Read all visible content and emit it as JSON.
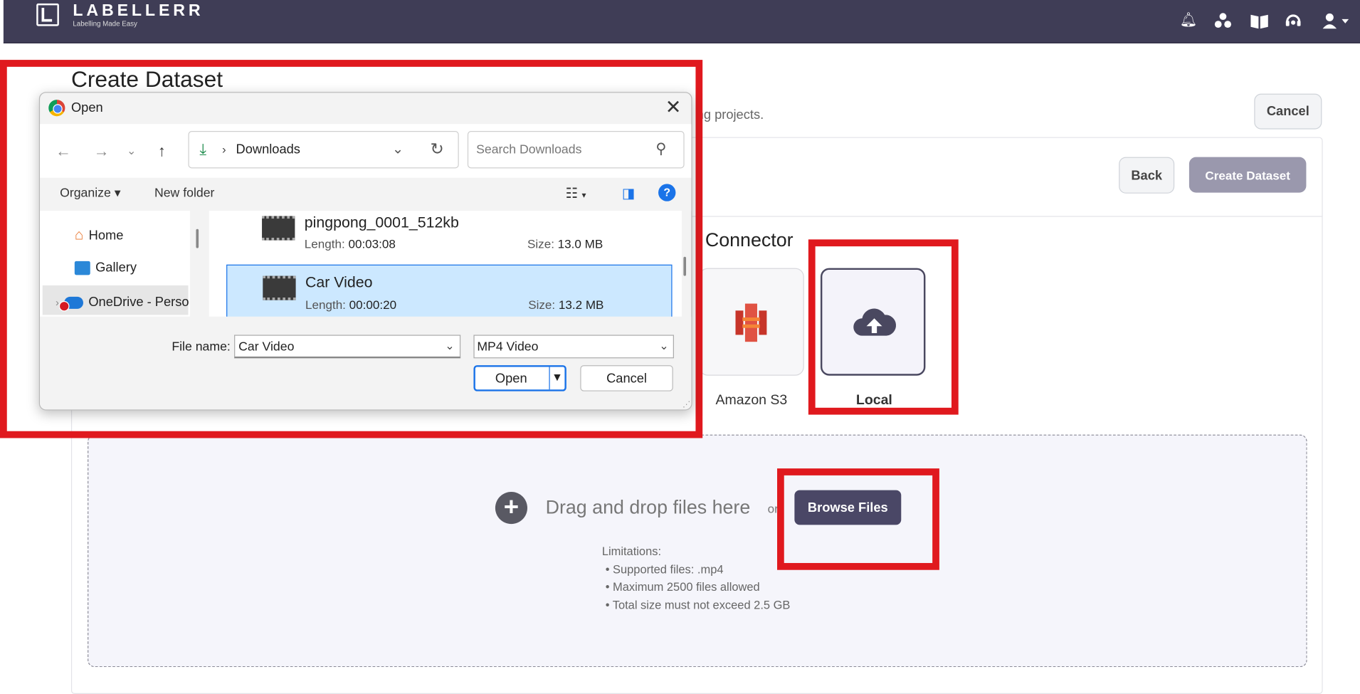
{
  "topbar": {
    "logo_name": "LABELLERR",
    "logo_tagline": "Labelling Made Easy",
    "icons": [
      "bell-icon",
      "team-icon",
      "book-icon",
      "support-icon",
      "user-icon"
    ]
  },
  "page": {
    "title": "Create Dataset",
    "subtitle_fragment": "ng projects.",
    "cancel_label": "Cancel",
    "back_label": "Back",
    "create_label": "Create Dataset"
  },
  "connector": {
    "title_fragment": "Connector",
    "tiles": [
      {
        "label": "Amazon S3",
        "icon": "amazon-s3-icon"
      },
      {
        "label": "Local",
        "icon": "cloud-upload-icon"
      }
    ]
  },
  "dropzone": {
    "drag_text": "Drag and drop files here",
    "or_text": "or",
    "browse_label": "Browse Files",
    "limits_title": "Limitations:",
    "limits": [
      "• Supported files: .mp4",
      "• Maximum 2500 files allowed",
      "• Total size must not exceed 2.5 GB"
    ]
  },
  "dialog": {
    "title": "Open",
    "address": "Downloads",
    "search_placeholder": "Search Downloads",
    "organize_label": "Organize",
    "new_folder_label": "New folder",
    "help_glyph": "?",
    "nav_items": [
      "Home",
      "Gallery",
      "OneDrive - Perso"
    ],
    "files": [
      {
        "name": "pingpong_0001_512kb",
        "length_label": "Length:",
        "length": "00:03:08",
        "size_label": "Size:",
        "size": "13.0 MB"
      },
      {
        "name": "Car Video",
        "length_label": "Length:",
        "length": "00:00:20",
        "size_label": "Size:",
        "size": "13.2 MB"
      }
    ],
    "file_name_label": "File name:",
    "file_name_value": "Car Video",
    "file_type": "MP4 Video",
    "open_label": "Open",
    "cancel_label": "Cancel"
  },
  "colors": {
    "topbar": "#3f3d56",
    "highlight": "#e0191e",
    "browse_button": "#4a4766",
    "selected_file": "#cce8ff"
  }
}
